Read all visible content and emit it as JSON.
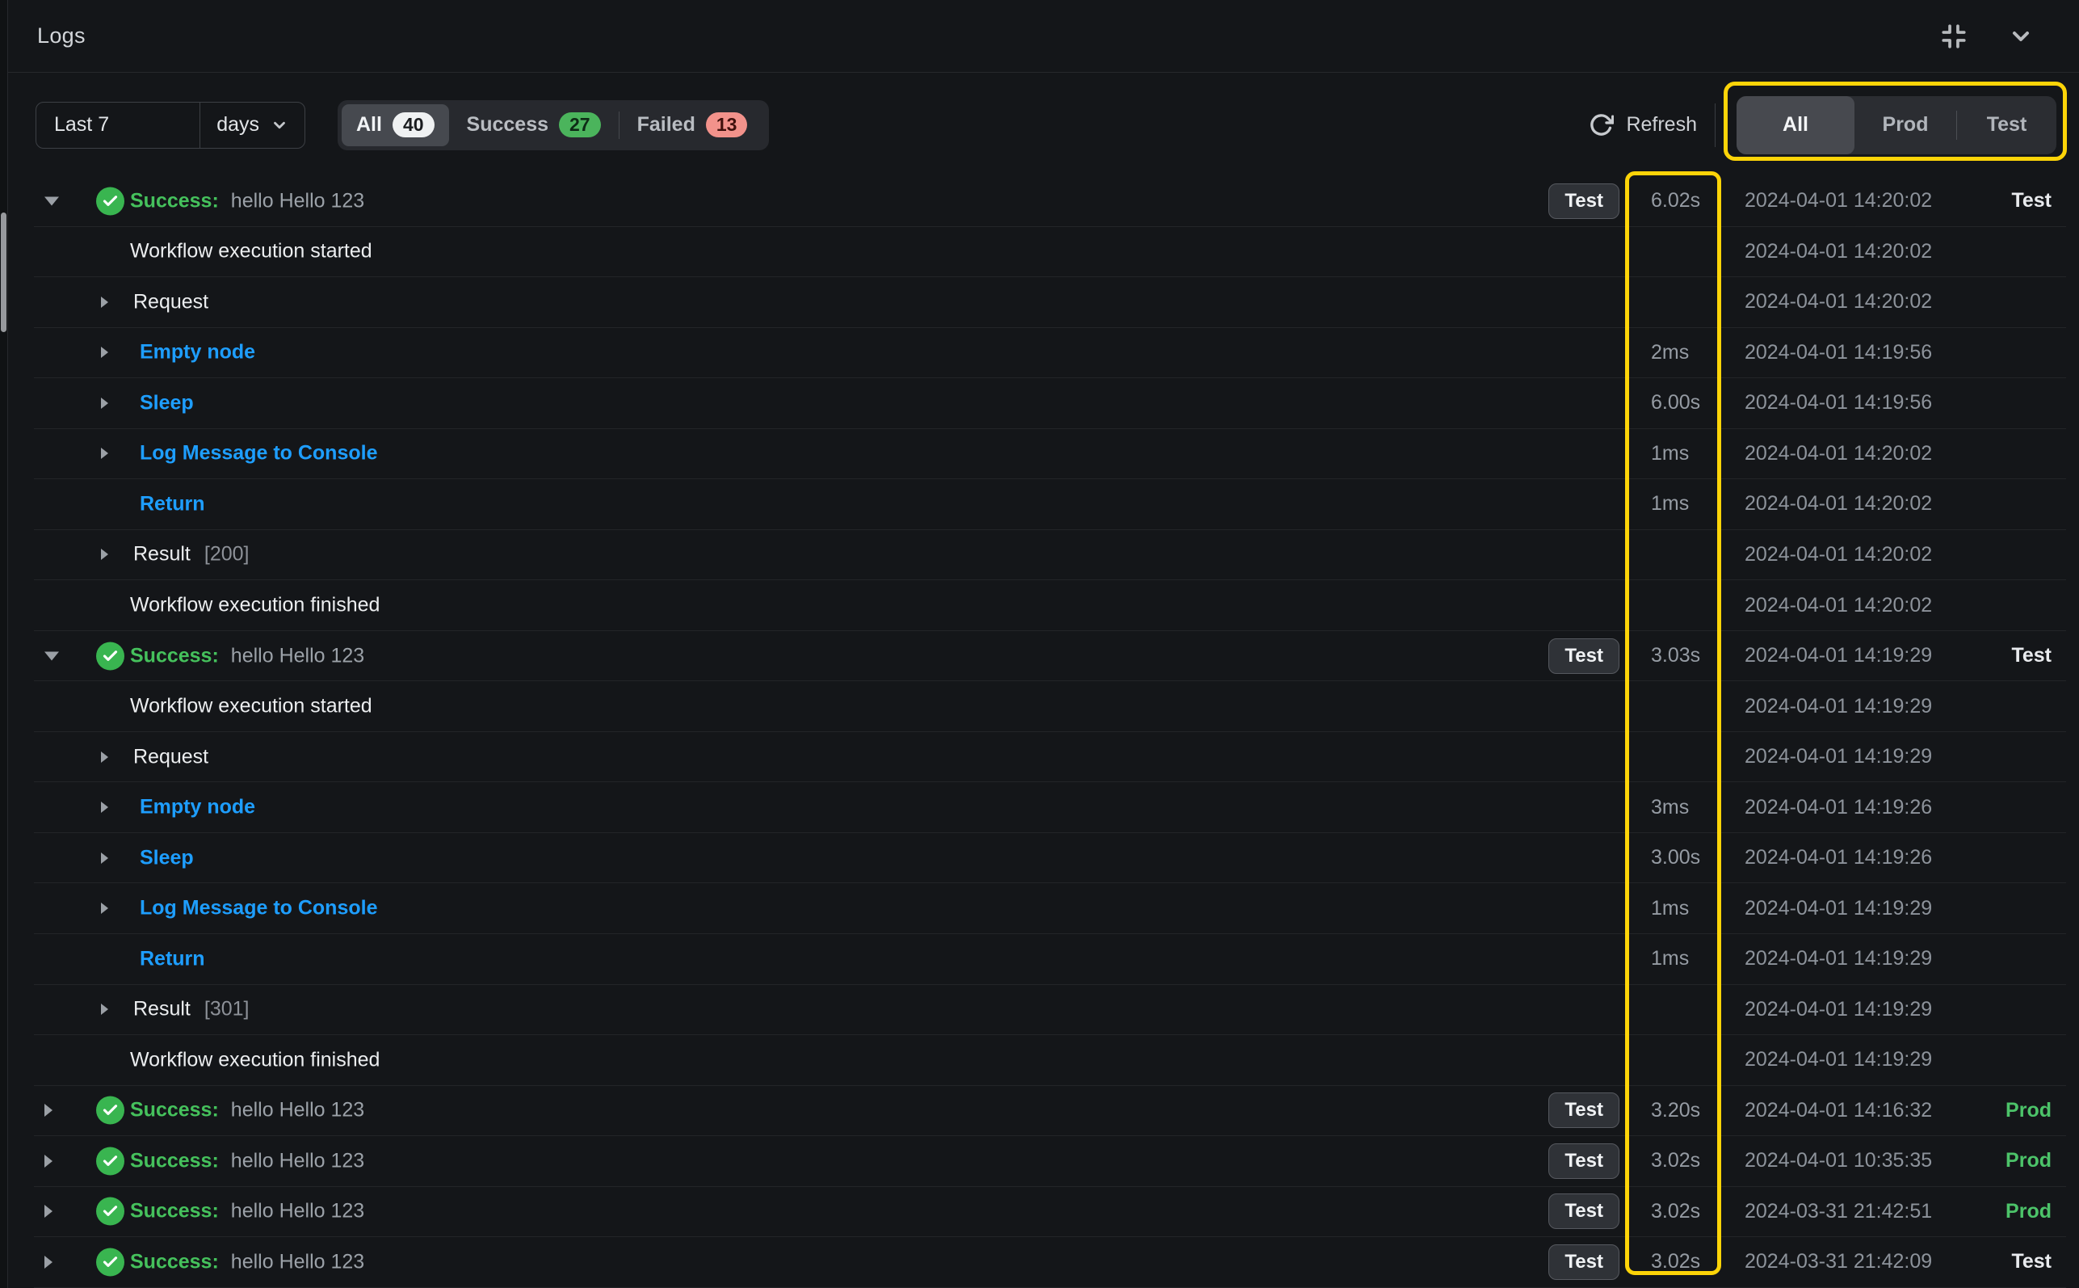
{
  "header": {
    "title": "Logs"
  },
  "filter": {
    "range_value": "Last 7",
    "range_unit": "days",
    "status_tabs": [
      {
        "label": "All",
        "count": "40",
        "selected": true
      },
      {
        "label": "Success",
        "count": "27",
        "selected": false
      },
      {
        "label": "Failed",
        "count": "13",
        "selected": false
      }
    ],
    "refresh_label": "Refresh",
    "env_tabs": [
      "All",
      "Prod",
      "Test"
    ],
    "env_selected": "All"
  },
  "colors": {
    "highlight": "#fdd408",
    "success_green": "#45c15c",
    "prod_green": "#4cc369",
    "link_blue": "#1e9eff",
    "badge_success": "#4bb45c",
    "badge_failed": "#f2928b",
    "badge_all": "#eff1f2"
  },
  "rows": [
    {
      "kind": "group",
      "caret": "down",
      "status_label": "Success:",
      "message": "hello Hello 123",
      "badge": "Test",
      "duration": "6.02s",
      "timestamp": "2024-04-01  14:20:02",
      "env": "Test",
      "env_style": "white"
    },
    {
      "kind": "event",
      "text": "Workflow execution started",
      "timestamp": "2024-04-01  14:20:02"
    },
    {
      "kind": "step",
      "caret": "right",
      "text": "Request",
      "color": "white",
      "timestamp": "2024-04-01  14:20:02"
    },
    {
      "kind": "step",
      "caret": "right",
      "text": "Empty node",
      "color": "blue",
      "duration": "2ms",
      "timestamp": "2024-04-01  14:19:56"
    },
    {
      "kind": "step",
      "caret": "right",
      "text": "Sleep",
      "color": "blue",
      "duration": "6.00s",
      "timestamp": "2024-04-01  14:19:56"
    },
    {
      "kind": "step",
      "caret": "right",
      "text": "Log Message to Console",
      "color": "blue",
      "duration": "1ms",
      "timestamp": "2024-04-01  14:20:02"
    },
    {
      "kind": "step",
      "caret": null,
      "text": "Return",
      "color": "blue",
      "duration": "1ms",
      "timestamp": "2024-04-01  14:20:02"
    },
    {
      "kind": "step",
      "caret": "right",
      "text": "Result",
      "suffix": "[200]",
      "color": "white",
      "timestamp": "2024-04-01  14:20:02"
    },
    {
      "kind": "event",
      "text": "Workflow execution finished",
      "timestamp": "2024-04-01  14:20:02"
    },
    {
      "kind": "group",
      "caret": "down",
      "status_label": "Success:",
      "message": "hello Hello 123",
      "badge": "Test",
      "duration": "3.03s",
      "timestamp": "2024-04-01  14:19:29",
      "env": "Test",
      "env_style": "white"
    },
    {
      "kind": "event",
      "text": "Workflow execution started",
      "timestamp": "2024-04-01  14:19:29"
    },
    {
      "kind": "step",
      "caret": "right",
      "text": "Request",
      "color": "white",
      "timestamp": "2024-04-01  14:19:29"
    },
    {
      "kind": "step",
      "caret": "right",
      "text": "Empty node",
      "color": "blue",
      "duration": "3ms",
      "timestamp": "2024-04-01  14:19:26"
    },
    {
      "kind": "step",
      "caret": "right",
      "text": "Sleep",
      "color": "blue",
      "duration": "3.00s",
      "timestamp": "2024-04-01  14:19:26"
    },
    {
      "kind": "step",
      "caret": "right",
      "text": "Log Message to Console",
      "color": "blue",
      "duration": "1ms",
      "timestamp": "2024-04-01  14:19:29"
    },
    {
      "kind": "step",
      "caret": null,
      "text": "Return",
      "color": "blue",
      "duration": "1ms",
      "timestamp": "2024-04-01  14:19:29"
    },
    {
      "kind": "step",
      "caret": "right",
      "text": "Result",
      "suffix": "[301]",
      "color": "white",
      "timestamp": "2024-04-01  14:19:29"
    },
    {
      "kind": "event",
      "text": "Workflow execution finished",
      "timestamp": "2024-04-01  14:19:29"
    },
    {
      "kind": "group",
      "caret": "right",
      "status_label": "Success:",
      "message": "hello Hello 123",
      "badge": "Test",
      "duration": "3.20s",
      "timestamp": "2024-04-01  14:16:32",
      "env": "Prod",
      "env_style": "green"
    },
    {
      "kind": "group",
      "caret": "right",
      "status_label": "Success:",
      "message": "hello Hello 123",
      "badge": "Test",
      "duration": "3.02s",
      "timestamp": "2024-04-01  10:35:35",
      "env": "Prod",
      "env_style": "green"
    },
    {
      "kind": "group",
      "caret": "right",
      "status_label": "Success:",
      "message": "hello Hello 123",
      "badge": "Test",
      "duration": "3.02s",
      "timestamp": "2024-03-31  21:42:51",
      "env": "Prod",
      "env_style": "green"
    },
    {
      "kind": "group",
      "caret": "right",
      "status_label": "Success:",
      "message": "hello Hello 123",
      "badge": "Test",
      "duration": "3.02s",
      "timestamp": "2024-03-31  21:42:09",
      "env": "Test",
      "env_style": "white"
    }
  ]
}
